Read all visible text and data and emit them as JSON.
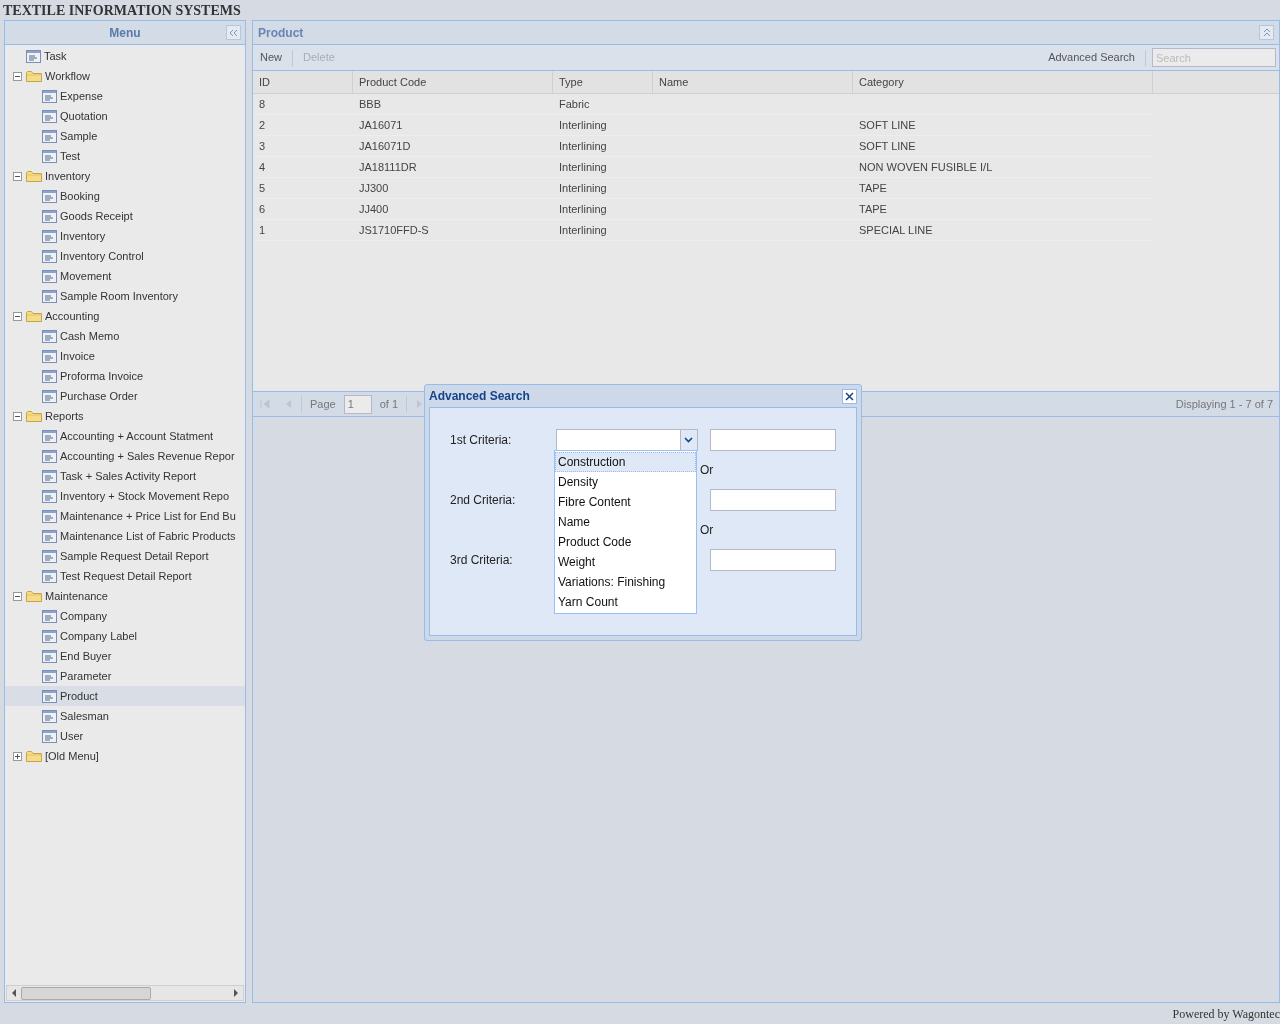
{
  "app_title": "TEXTILE INFORMATION SYSTEMS",
  "menu": {
    "title": "Menu",
    "items": [
      {
        "label": "Task",
        "kind": "leaf",
        "selected": false
      },
      {
        "label": "Workflow",
        "kind": "folder",
        "expanded": true,
        "children": [
          {
            "label": "Expense",
            "kind": "leaf",
            "selected": false
          },
          {
            "label": "Quotation",
            "kind": "leaf",
            "selected": false
          },
          {
            "label": "Sample",
            "kind": "leaf",
            "selected": false
          },
          {
            "label": "Test",
            "kind": "leaf",
            "selected": false
          }
        ]
      },
      {
        "label": "Inventory",
        "kind": "folder",
        "expanded": true,
        "children": [
          {
            "label": "Booking",
            "kind": "leaf",
            "selected": false
          },
          {
            "label": "Goods Receipt",
            "kind": "leaf",
            "selected": false
          },
          {
            "label": "Inventory",
            "kind": "leaf",
            "selected": false
          },
          {
            "label": "Inventory Control",
            "kind": "leaf",
            "selected": false
          },
          {
            "label": "Movement",
            "kind": "leaf",
            "selected": false
          },
          {
            "label": "Sample Room Inventory",
            "kind": "leaf",
            "selected": false
          }
        ]
      },
      {
        "label": "Accounting",
        "kind": "folder",
        "expanded": true,
        "children": [
          {
            "label": "Cash Memo",
            "kind": "leaf",
            "selected": false
          },
          {
            "label": "Invoice",
            "kind": "leaf",
            "selected": false
          },
          {
            "label": "Proforma Invoice",
            "kind": "leaf",
            "selected": false
          },
          {
            "label": "Purchase Order",
            "kind": "leaf",
            "selected": false
          }
        ]
      },
      {
        "label": "Reports",
        "kind": "folder",
        "expanded": true,
        "children": [
          {
            "label": "Accounting + Account Statment",
            "kind": "leaf",
            "selected": false
          },
          {
            "label": "Accounting + Sales Revenue Repor",
            "kind": "leaf",
            "selected": false
          },
          {
            "label": "Task + Sales Activity Report",
            "kind": "leaf",
            "selected": false
          },
          {
            "label": "Inventory + Stock Movement Repo",
            "kind": "leaf",
            "selected": false
          },
          {
            "label": "Maintenance + Price List for End Bu",
            "kind": "leaf",
            "selected": false
          },
          {
            "label": "Maintenance List of Fabric Products",
            "kind": "leaf",
            "selected": false
          },
          {
            "label": "Sample Request Detail Report",
            "kind": "leaf",
            "selected": false
          },
          {
            "label": "Test Request Detail Report",
            "kind": "leaf",
            "selected": false
          }
        ]
      },
      {
        "label": "Maintenance",
        "kind": "folder",
        "expanded": true,
        "children": [
          {
            "label": "Company",
            "kind": "leaf",
            "selected": false
          },
          {
            "label": "Company Label",
            "kind": "leaf",
            "selected": false
          },
          {
            "label": "End Buyer",
            "kind": "leaf",
            "selected": false
          },
          {
            "label": "Parameter",
            "kind": "leaf",
            "selected": false
          },
          {
            "label": "Product",
            "kind": "leaf",
            "selected": true
          },
          {
            "label": "Salesman",
            "kind": "leaf",
            "selected": false
          },
          {
            "label": "User",
            "kind": "leaf",
            "selected": false
          }
        ]
      },
      {
        "label": "[Old Menu]",
        "kind": "folder",
        "expanded": false
      }
    ]
  },
  "panel": {
    "title": "Product",
    "toolbar": {
      "buttons": [
        {
          "label": "New",
          "disabled": false
        },
        {
          "label": "Delete",
          "disabled": true
        }
      ],
      "advanced_search": "Advanced Search",
      "search": {
        "placeholder": "Search"
      }
    },
    "table": {
      "columns": [
        "ID",
        "Product Code",
        "Type",
        "Name",
        "Category"
      ],
      "rows": [
        [
          "8",
          "BBB",
          "Fabric",
          "",
          ""
        ],
        [
          "2",
          "JA16071",
          "Interlining",
          "",
          "SOFT LINE"
        ],
        [
          "3",
          "JA16071D",
          "Interlining",
          "",
          "SOFT LINE"
        ],
        [
          "4",
          "JA18111DR",
          "Interlining",
          "",
          "NON WOVEN FUSIBLE I/L"
        ],
        [
          "5",
          "JJ300",
          "Interlining",
          "",
          "TAPE"
        ],
        [
          "6",
          "JJ400",
          "Interlining",
          "",
          "TAPE"
        ],
        [
          "1",
          "JS1710FFD-S",
          "Interlining",
          "",
          "SPECIAL LINE"
        ]
      ]
    },
    "paging": {
      "page_label": "Page",
      "page": "1",
      "of": "of 1",
      "displaying": "Displaying 1 - 7 of 7"
    }
  },
  "dialog": {
    "title": "Advanced Search",
    "criteria": [
      {
        "label": "1st Criteria:"
      },
      {
        "label": "2nd Criteria:"
      },
      {
        "label": "3rd Criteria:"
      }
    ],
    "or_labels": [
      "Or",
      "Or"
    ],
    "dropdown": [
      {
        "label": "Construction",
        "selected": true
      },
      {
        "label": "Density",
        "selected": false
      },
      {
        "label": "Fibre Content",
        "selected": false
      },
      {
        "label": "Name",
        "selected": false
      },
      {
        "label": "Product Code",
        "selected": false
      },
      {
        "label": "Weight",
        "selected": false
      },
      {
        "label": "Variations: Finishing",
        "selected": false
      },
      {
        "label": "Yarn Count",
        "selected": false
      }
    ]
  },
  "footer": "Powered by Wagontec"
}
